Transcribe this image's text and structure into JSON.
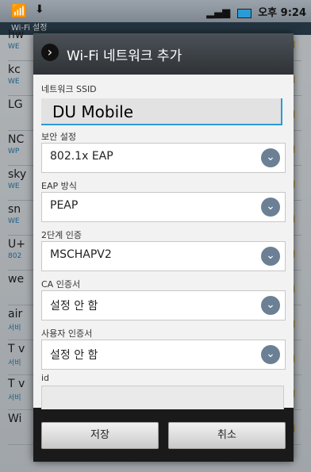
{
  "status": {
    "wifi_icon": "wifi-icon",
    "download_icon": "download-icon",
    "time_label": "오후 9:24",
    "battery_icon": "battery-icon"
  },
  "background_list": {
    "title": "Wi-Fi 설정",
    "items": [
      {
        "name": "hw",
        "desc": "WE"
      },
      {
        "name": "kc",
        "desc": "WE"
      },
      {
        "name": "LG",
        "desc": ""
      },
      {
        "name": "NC",
        "desc": "WP"
      },
      {
        "name": "sky",
        "desc": "WE"
      },
      {
        "name": "sn",
        "desc": "WE"
      },
      {
        "name": "U+",
        "desc": "802"
      },
      {
        "name": "we",
        "desc": ""
      },
      {
        "name": "air",
        "desc": "서비"
      },
      {
        "name": "T v",
        "desc": "서비"
      },
      {
        "name": "T v",
        "desc": "서비"
      },
      {
        "name": "Wi",
        "desc": ""
      }
    ]
  },
  "dialog": {
    "title": "Wi-Fi 네트워크 추가",
    "ssid_label": "네트워크 SSID",
    "ssid_value": "DU Mobile",
    "security_label": "보안 설정",
    "security_value": "802.1x EAP",
    "eap_label": "EAP 방식",
    "eap_value": "PEAP",
    "phase2_label": "2단계 인증",
    "phase2_value": "MSCHAPV2",
    "ca_label": "CA 인증서",
    "ca_value": "설정 안 함",
    "user_cert_label": "사용자 인증서",
    "user_cert_value": "설정 안 함",
    "id_label": "id",
    "id_value": "",
    "save_button": "저장",
    "cancel_button": "취소"
  }
}
